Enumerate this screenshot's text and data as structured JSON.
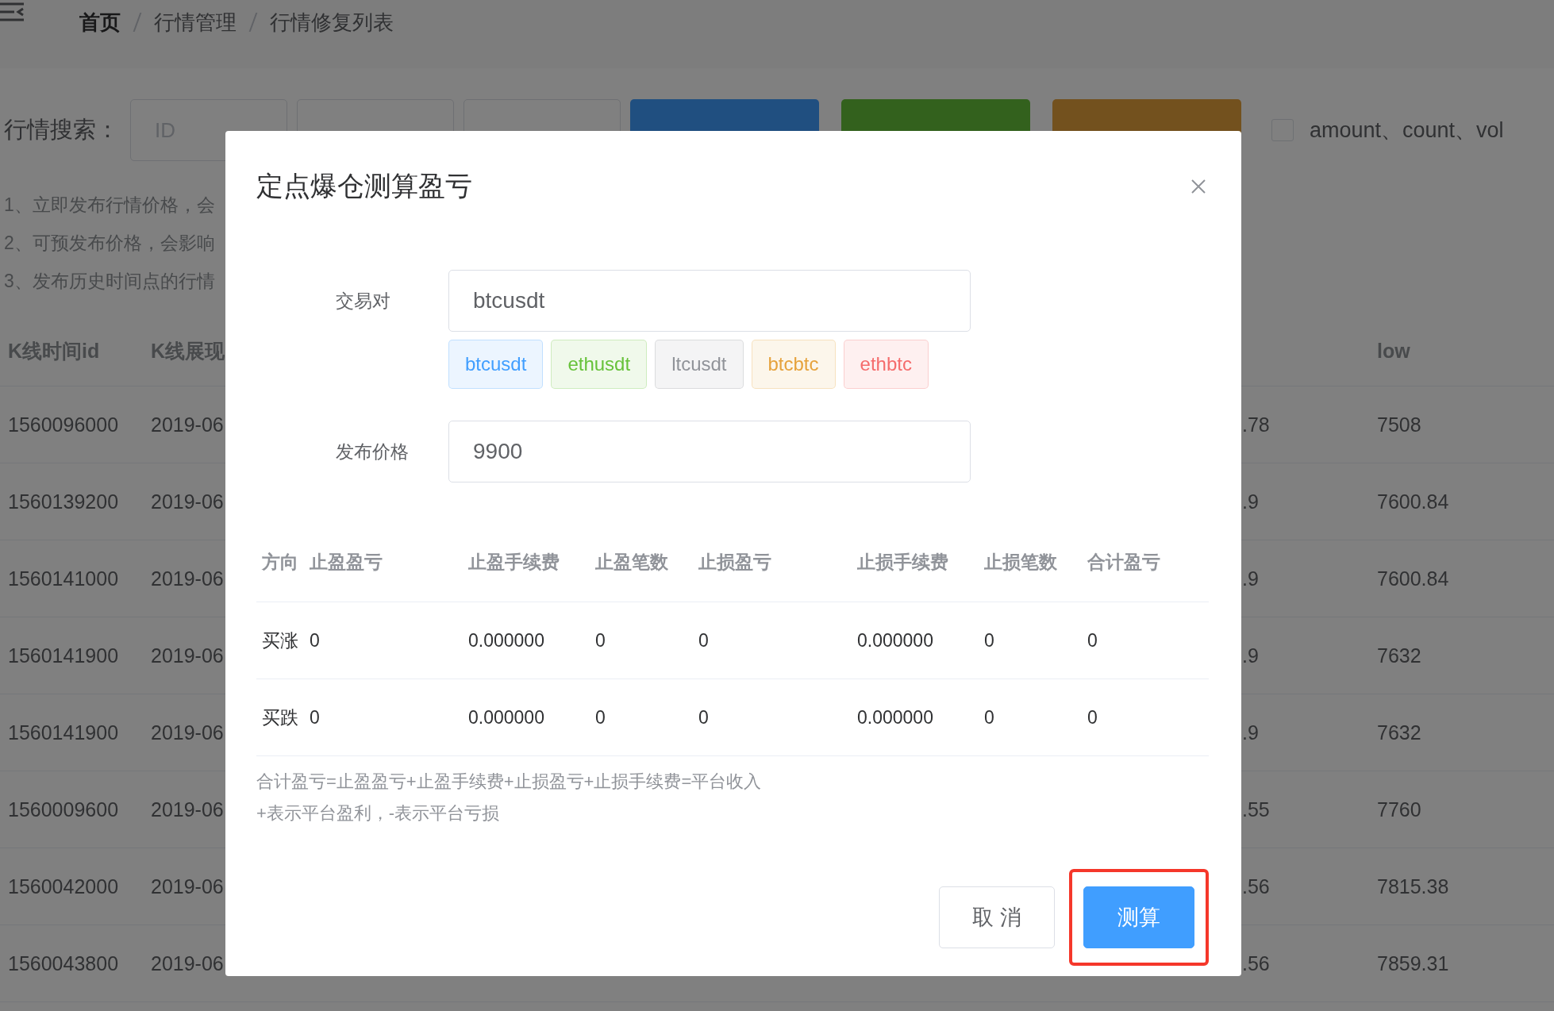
{
  "breadcrumb": [
    "首页",
    "行情管理",
    "行情修复列表"
  ],
  "search": {
    "label": "行情搜索：",
    "fields": [
      {
        "kind": "input",
        "placeholder": "ID"
      },
      {
        "kind": "input"
      },
      {
        "kind": "input"
      }
    ],
    "buttons": [
      {
        "color": "#204f80"
      },
      {
        "color": "#33611d"
      },
      {
        "color": "#73511e"
      }
    ],
    "checkbox": {
      "label": "amount、count、vol",
      "checked": false
    }
  },
  "notes": [
    "1、立即发布行情价格，会",
    "2、可预发布价格，会影响",
    "3、发布历史时间点的行情"
  ],
  "table": {
    "columns": [
      {
        "label": "K线时间id"
      },
      {
        "label": "K线展现"
      },
      {},
      {
        "label": "low"
      }
    ],
    "rows": [
      [
        "1560096000",
        "2019-06",
        ".78",
        "7508"
      ],
      [
        "1560139200",
        "2019-06",
        ".9",
        "7600.84"
      ],
      [
        "1560141000",
        "2019-06",
        ".9",
        "7600.84"
      ],
      [
        "1560141900",
        "2019-06",
        ".9",
        "7632"
      ],
      [
        "1560141900",
        "2019-06",
        ".9",
        "7632"
      ],
      [
        "1560009600",
        "2019-06",
        ".55",
        "7760"
      ],
      [
        "1560042000",
        "2019-06",
        ".56",
        "7815.38"
      ],
      [
        "1560043800",
        "2019-06",
        ".56",
        "7859.31"
      ]
    ]
  },
  "dialog": {
    "title": "定点爆仓测算盈亏",
    "fields": [
      {
        "label": "交易对",
        "value": "btcusdt",
        "tags": [
          {
            "label": "btcusdt",
            "color": "#409eff"
          },
          {
            "label": "ethusdt",
            "color": "#67c23a"
          },
          {
            "label": "ltcusdt",
            "color": "#909399"
          },
          {
            "label": "btcbtc",
            "color": "#e6a23c"
          },
          {
            "label": "ethbtc",
            "color": "#f56c6c"
          }
        ]
      },
      {
        "label": "发布价格",
        "value": "9900"
      }
    ],
    "table": {
      "columns": [
        "方向",
        "止盈盈亏",
        "止盈手续费",
        "止盈笔数",
        "止损盈亏",
        "止损手续费",
        "止损笔数",
        "合计盈亏"
      ],
      "rows": [
        [
          "买涨",
          "0",
          "0.000000",
          "0",
          "0",
          "0.000000",
          "0",
          "0"
        ],
        [
          "买跌",
          "0",
          "0.000000",
          "0",
          "0",
          "0.000000",
          "0",
          "0"
        ]
      ]
    },
    "notes": [
      "合计盈亏=止盈盈亏+止盈手续费+止损盈亏+止损手续费=平台收入",
      "+表示平台盈利，-表示平台亏损"
    ],
    "buttons": [
      {
        "label": "取 消",
        "kind": "default",
        "highlighted": false
      },
      {
        "label": "测算",
        "kind": "primary",
        "highlighted": true
      }
    ]
  }
}
